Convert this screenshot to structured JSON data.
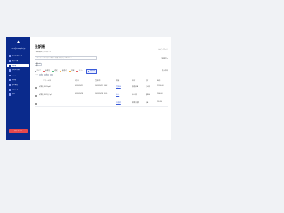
{
  "sidebar": {
    "user": "user@example.jp",
    "items": [
      {
        "label": "ダッシュボード",
        "active": false
      },
      {
        "label": "取引一覧",
        "active": false
      },
      {
        "label": "仕訳帳",
        "active": true
      },
      {
        "label": "総勘定元帳",
        "active": false
      },
      {
        "label": "試算表",
        "active": false
      },
      {
        "label": "決算書",
        "active": false
      },
      {
        "label": "固定資産",
        "active": false
      },
      {
        "label": "レポート",
        "active": false
      },
      {
        "label": "設定",
        "active": false
      }
    ],
    "logout_label": "ログアウト"
  },
  "main": {
    "title": "仕訳帳",
    "top_link": "ヘルプ・ガイド",
    "description": "・仕訳帳をダウンロード",
    "search_placeholder": "キーワードを入力して検索（摘要・取引先・金額など）",
    "right_link": "詳細検索 ▸",
    "sort_label": "新しい順",
    "filters": [
      {
        "label": "すべて",
        "color": "#8a8f99",
        "active": false
      },
      {
        "label": "未確定",
        "color": "#e5484d",
        "active": false
      },
      {
        "label": "確定",
        "color": "#3cb371",
        "active": false
      },
      {
        "label": "要確認",
        "color": "#f5a623",
        "active": false
      },
      {
        "label": "保留",
        "color": "#f5a623",
        "active": false
      },
      {
        "label": "エラー",
        "color": "#e5484d",
        "active": false
      },
      {
        "label": "自動仕訳",
        "color": "#3a5bd9",
        "active": true
      }
    ],
    "filter_right": "表示件数",
    "count_text": "全3件",
    "pages": [
      "1",
      "2",
      "›"
    ],
    "columns": [
      "ファイル名",
      "取引日",
      "登録日時",
      "摘要",
      "借方",
      "貸方",
      "金額"
    ],
    "rows": [
      {
        "file": "請求書_2023.pdf",
        "date": "2023/09/21",
        "registered": "2023/09/21 14:02",
        "memo": "売掛金",
        "debit": "普通預金",
        "credit": "売上高",
        "amount": "¥120,000"
      },
      {
        "file": "請求書_2023_2.pdf",
        "date": "2023/09/18",
        "registered": "2023/09/18 10:45",
        "memo": "仕入",
        "debit": "仕入高",
        "credit": "買掛金",
        "amount": "¥54,000"
      },
      {
        "file": "",
        "date": "",
        "registered": "",
        "memo": "交通費",
        "debit": "旅費交通費",
        "credit": "現金",
        "amount": "¥3,200"
      }
    ]
  }
}
